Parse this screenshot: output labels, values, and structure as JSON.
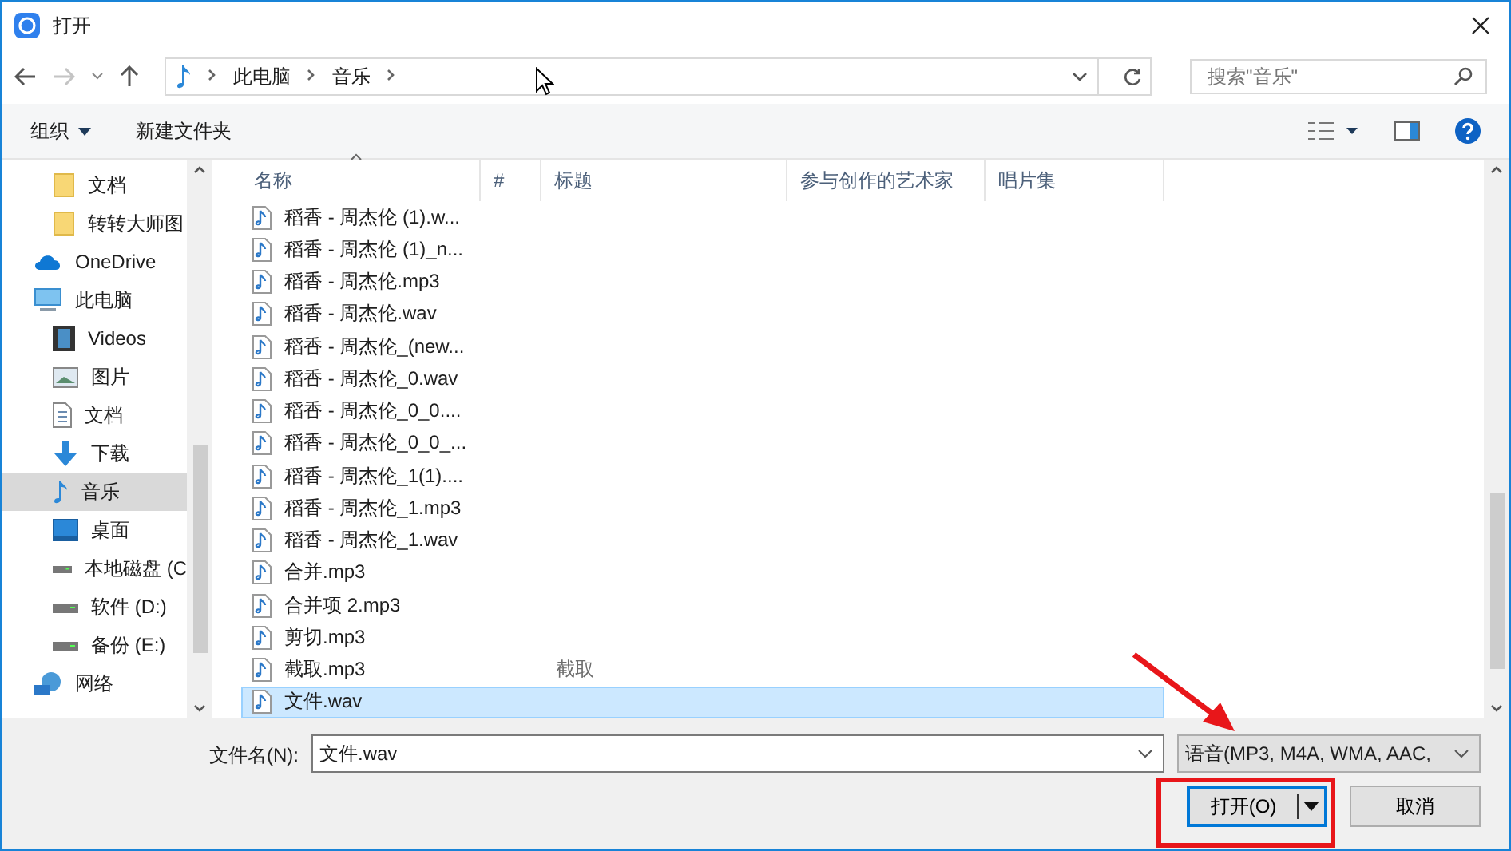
{
  "window": {
    "title": "打开"
  },
  "address": {
    "crumbs": [
      "此电脑",
      "音乐"
    ]
  },
  "search": {
    "placeholder": "搜索\"音乐\""
  },
  "toolbar": {
    "organize": "组织",
    "new_folder": "新建文件夹"
  },
  "sidebar": {
    "items": [
      {
        "label": "文档",
        "kind": "folder",
        "indent": true,
        "selected": false
      },
      {
        "label": "转转大师图",
        "kind": "folder",
        "indent": true,
        "selected": false
      },
      {
        "label": "OneDrive",
        "kind": "cloud",
        "indent": false,
        "selected": false
      },
      {
        "label": "此电脑",
        "kind": "pc",
        "indent": false,
        "selected": false
      },
      {
        "label": "Videos",
        "kind": "video",
        "indent": true,
        "selected": false
      },
      {
        "label": "图片",
        "kind": "picture",
        "indent": true,
        "selected": false
      },
      {
        "label": "文档",
        "kind": "document",
        "indent": true,
        "selected": false
      },
      {
        "label": "下载",
        "kind": "download",
        "indent": true,
        "selected": false
      },
      {
        "label": "音乐",
        "kind": "music",
        "indent": true,
        "selected": true
      },
      {
        "label": "桌面",
        "kind": "desktop",
        "indent": true,
        "selected": false
      },
      {
        "label": "本地磁盘 (C",
        "kind": "drive",
        "indent": true,
        "selected": false
      },
      {
        "label": "软件 (D:)",
        "kind": "drive",
        "indent": true,
        "selected": false
      },
      {
        "label": "备份 (E:)",
        "kind": "drive",
        "indent": true,
        "selected": false
      },
      {
        "label": "网络",
        "kind": "network",
        "indent": false,
        "selected": false
      }
    ]
  },
  "table": {
    "columns": [
      "名称",
      "#",
      "标题",
      "参与创作的艺术家",
      "唱片集"
    ],
    "rows": [
      {
        "name": "稻香 - 周杰伦 (1).w...",
        "title": "",
        "selected": false
      },
      {
        "name": "稻香 - 周杰伦 (1)_n...",
        "title": "",
        "selected": false
      },
      {
        "name": "稻香 - 周杰伦.mp3",
        "title": "",
        "selected": false
      },
      {
        "name": "稻香 - 周杰伦.wav",
        "title": "",
        "selected": false
      },
      {
        "name": "稻香 - 周杰伦_(new...",
        "title": "",
        "selected": false
      },
      {
        "name": "稻香 - 周杰伦_0.wav",
        "title": "",
        "selected": false
      },
      {
        "name": "稻香 - 周杰伦_0_0....",
        "title": "",
        "selected": false
      },
      {
        "name": "稻香 - 周杰伦_0_0_...",
        "title": "",
        "selected": false
      },
      {
        "name": "稻香 - 周杰伦_1(1)....",
        "title": "",
        "selected": false
      },
      {
        "name": "稻香 - 周杰伦_1.mp3",
        "title": "",
        "selected": false
      },
      {
        "name": "稻香 - 周杰伦_1.wav",
        "title": "",
        "selected": false
      },
      {
        "name": "合并.mp3",
        "title": "",
        "selected": false
      },
      {
        "name": "合并项 2.mp3",
        "title": "",
        "selected": false
      },
      {
        "name": "剪切.mp3",
        "title": "",
        "selected": false
      },
      {
        "name": "截取.mp3",
        "title": "截取",
        "selected": false
      },
      {
        "name": "文件.wav",
        "title": "",
        "selected": true
      }
    ]
  },
  "footer": {
    "filename_label": "文件名(N):",
    "filename": "文件.wav",
    "file_type": "语音(MP3, M4A, WMA, AAC,",
    "open_button": "打开(O)",
    "cancel_button": "取消"
  }
}
